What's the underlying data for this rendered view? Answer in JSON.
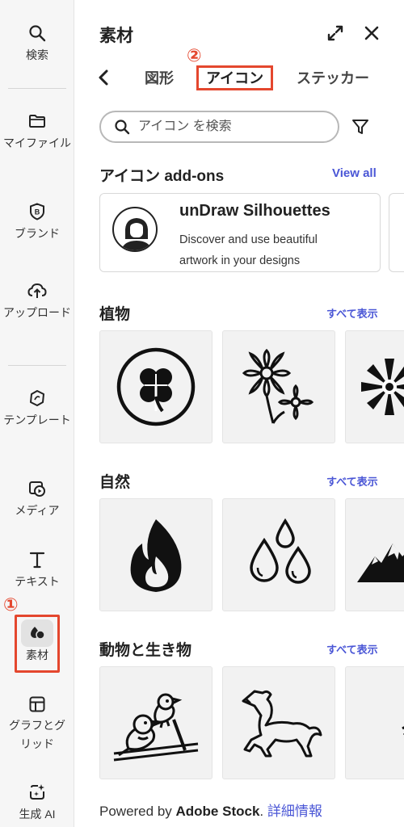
{
  "rail": {
    "items": [
      {
        "label": "検索",
        "icon": "search-icon"
      },
      {
        "label": "マイファイル",
        "icon": "folder-icon"
      },
      {
        "label": "ブランド",
        "icon": "brand-icon"
      },
      {
        "label": "アップロード",
        "icon": "upload-icon"
      },
      {
        "label": "テンプレート",
        "icon": "template-icon"
      },
      {
        "label": "メディア",
        "icon": "media-icon"
      },
      {
        "label": "テキスト",
        "icon": "text-icon"
      },
      {
        "label": "素材",
        "icon": "elements-icon"
      },
      {
        "label": "グラフとグリッド",
        "icon": "grid-icon"
      },
      {
        "label": "生成 AI",
        "icon": "ai-icon"
      }
    ],
    "active": "素材",
    "step_marker": "①"
  },
  "panel": {
    "title": "素材",
    "tabs": [
      {
        "label": "図形"
      },
      {
        "label": "アイコン",
        "active": true
      },
      {
        "label": "ステッカー"
      }
    ],
    "step_marker": "②",
    "search": {
      "placeholder": "アイコン を検索"
    },
    "addons": {
      "title": "アイコン add-ons",
      "view_all": "View all",
      "card": {
        "title": "unDraw Silhouettes",
        "description": "Discover and use beautiful artwork in your designs"
      }
    },
    "sections": [
      {
        "title": "植物",
        "see_all": "すべて表示",
        "tiles": [
          "clover-icon",
          "flowers-icon",
          "lotus-icon"
        ]
      },
      {
        "title": "自然",
        "see_all": "すべて表示",
        "tiles": [
          "fire-icon",
          "water-drops-icon",
          "mountains-icon"
        ]
      },
      {
        "title": "動物と生き物",
        "see_all": "すべて表示",
        "tiles": [
          "birds-icon",
          "horse-icon",
          "bird-partial-icon"
        ]
      }
    ],
    "footer": {
      "prefix": "Powered by ",
      "brand": "Adobe Stock",
      "suffix": ". ",
      "link": "詳細情報"
    }
  },
  "colors": {
    "accent_link": "#4a56d6",
    "highlight_red": "#e4472e",
    "rail_bg": "#f6f6f6",
    "tile_bg": "#f2f2f2"
  }
}
